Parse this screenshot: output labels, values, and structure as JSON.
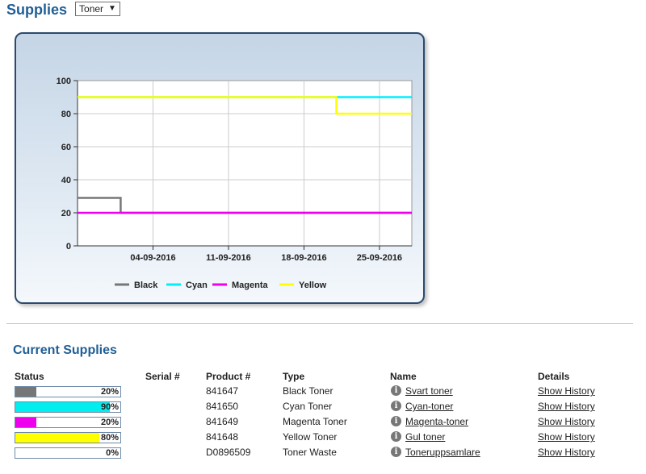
{
  "header": {
    "title": "Supplies",
    "select_value": "Toner",
    "select_arrow": "▼"
  },
  "chart_data": {
    "type": "line",
    "ylim": [
      0,
      100
    ],
    "yticks": [
      "0",
      "20",
      "40",
      "60",
      "80",
      "100"
    ],
    "x_tick_labels": [
      "04-09-2016",
      "11-09-2016",
      "18-09-2016",
      "25-09-2016"
    ],
    "x_tick_values": [
      7,
      14,
      21,
      28
    ],
    "xlim": [
      0,
      31
    ],
    "grid": true,
    "legend_position": "bottom",
    "series": [
      {
        "name": "Black",
        "color": "#777777",
        "step": true,
        "points": [
          [
            0,
            29
          ],
          [
            4,
            29
          ],
          [
            4,
            20
          ],
          [
            31,
            20
          ]
        ]
      },
      {
        "name": "Cyan",
        "color": "#00eeff",
        "step": true,
        "points": [
          [
            0,
            90
          ],
          [
            31,
            90
          ]
        ]
      },
      {
        "name": "Magenta",
        "color": "#ee00ee",
        "step": true,
        "points": [
          [
            0,
            20
          ],
          [
            31,
            20
          ]
        ]
      },
      {
        "name": "Yellow",
        "color": "#ffff00",
        "step": true,
        "points": [
          [
            0,
            90
          ],
          [
            24,
            90
          ],
          [
            24,
            80
          ],
          [
            31,
            80
          ]
        ]
      }
    ]
  },
  "current": {
    "title": "Current Supplies",
    "headers": {
      "status": "Status",
      "serial": "Serial #",
      "product": "Product #",
      "type": "Type",
      "name": "Name",
      "details": "Details"
    },
    "rows": [
      {
        "pct_label": "20%",
        "fill": 0.2,
        "color": "#777777",
        "serial": "",
        "product": "841647",
        "type": "Black Toner",
        "name": "Svart toner",
        "details": "Show History"
      },
      {
        "pct_label": "90%",
        "fill": 0.9,
        "color": "#00eeee",
        "serial": "",
        "product": "841650",
        "type": "Cyan Toner",
        "name": "Cyan-toner",
        "details": "Show History"
      },
      {
        "pct_label": "20%",
        "fill": 0.2,
        "color": "#ee00ee",
        "serial": "",
        "product": "841649",
        "type": "Magenta Toner",
        "name": "Magenta-toner",
        "details": "Show History"
      },
      {
        "pct_label": "80%",
        "fill": 0.8,
        "color": "#ffff00",
        "serial": "",
        "product": "841648",
        "type": "Yellow Toner",
        "name": "Gul toner",
        "details": "Show History"
      },
      {
        "pct_label": "0%",
        "fill": 0.0,
        "color": "#ffffff",
        "serial": "",
        "product": "D0896509",
        "type": "Toner Waste",
        "name": "Toneruppsamlare",
        "details": "Show History"
      }
    ]
  }
}
